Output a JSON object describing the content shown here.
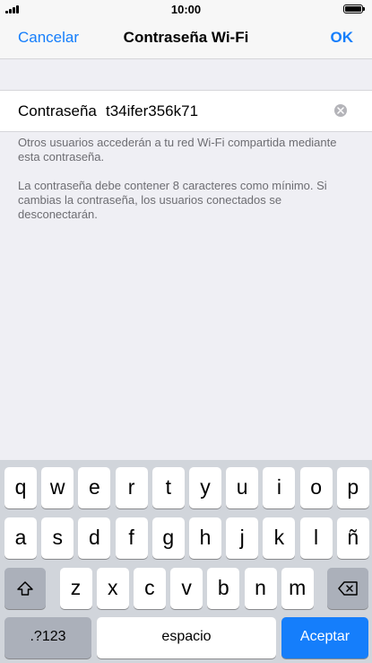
{
  "status_bar": {
    "time": "10:00",
    "icons": [
      "signal-icon",
      "battery-icon"
    ]
  },
  "nav": {
    "cancel_label": "Cancelar",
    "title": "Contraseña Wi-Fi",
    "ok_label": "OK"
  },
  "password_field": {
    "label": "Contraseña",
    "value": "t34ifer356k71",
    "clear_icon": "clear-icon"
  },
  "info": {
    "note_1": "Otros usuarios accederán a tu red Wi-Fi compartida mediante esta contraseña.",
    "note_2": "La contraseña debe contener 8 caracteres como mínimo. Si cambias la contraseña, los usuarios conectados se desconectarán."
  },
  "keyboard": {
    "row1": [
      "q",
      "w",
      "e",
      "r",
      "t",
      "y",
      "u",
      "i",
      "o",
      "p"
    ],
    "row2": [
      "a",
      "s",
      "d",
      "f",
      "g",
      "h",
      "j",
      "k",
      "l",
      "ñ"
    ],
    "row3": [
      "z",
      "x",
      "c",
      "v",
      "b",
      "n",
      "m"
    ],
    "shift_icon": "shift-icon",
    "delete_icon": "backspace-icon",
    "numbers_label": ".?123",
    "space_label": "espacio",
    "accept_label": "Aceptar"
  },
  "colors": {
    "accent": "#157efb",
    "background": "#efeff4",
    "keyboard_bg": "#d1d5db"
  }
}
